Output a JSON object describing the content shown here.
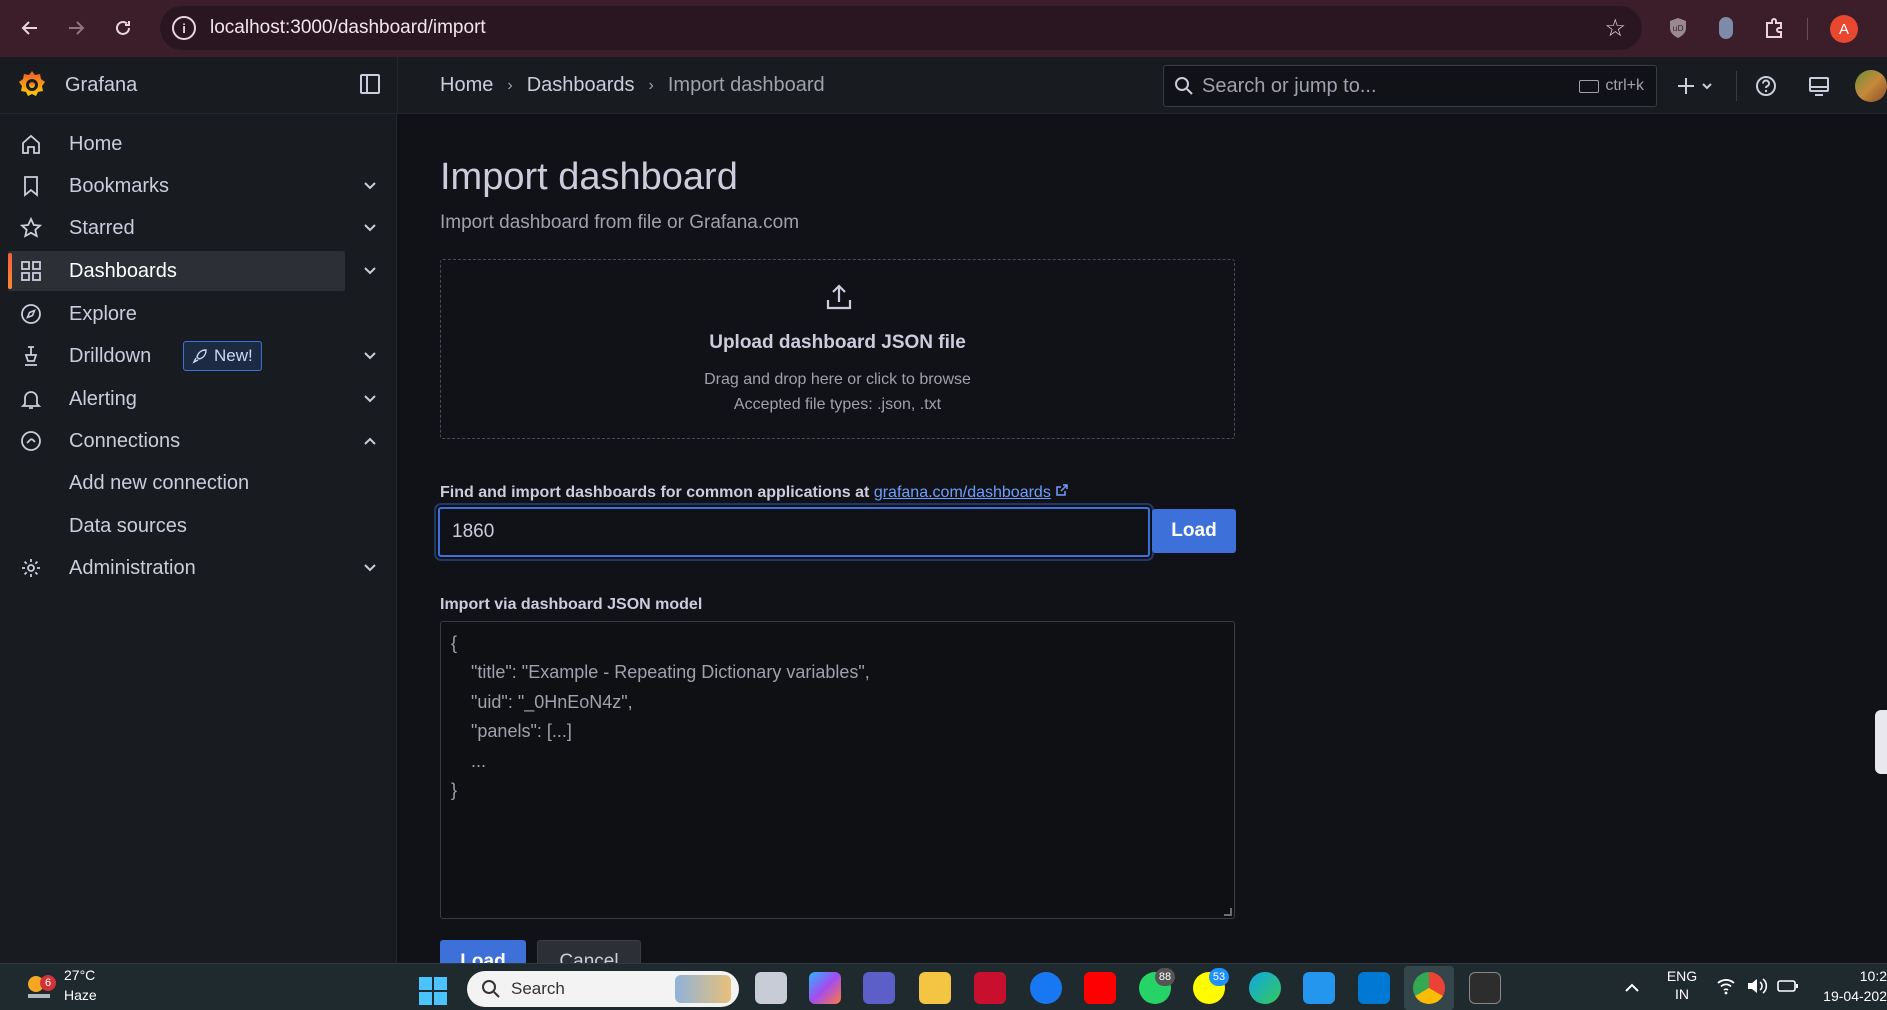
{
  "browser": {
    "url": "localhost:3000/dashboard/import",
    "profile_initial": "A"
  },
  "header": {
    "brand": "Grafana",
    "breadcrumb": [
      "Home",
      "Dashboards",
      "Import dashboard"
    ],
    "search_placeholder": "Search or jump to...",
    "search_shortcut": "ctrl+k"
  },
  "sidebar": {
    "items": [
      {
        "label": "Home",
        "icon": "home-icon"
      },
      {
        "label": "Bookmarks",
        "icon": "bookmark-icon",
        "expandable": true
      },
      {
        "label": "Starred",
        "icon": "star-icon",
        "expandable": true
      },
      {
        "label": "Dashboards",
        "icon": "apps-icon",
        "expandable": true,
        "active": true
      },
      {
        "label": "Explore",
        "icon": "compass-icon"
      },
      {
        "label": "Drilldown",
        "icon": "drilldown-icon",
        "expandable": true,
        "badge": "New!"
      },
      {
        "label": "Alerting",
        "icon": "bell-icon",
        "expandable": true
      },
      {
        "label": "Connections",
        "icon": "link-icon",
        "expanded": true
      },
      {
        "label": "Add new connection"
      },
      {
        "label": "Data sources"
      },
      {
        "label": "Administration",
        "icon": "cog-icon",
        "expandable": true
      }
    ]
  },
  "main": {
    "title": "Import dashboard",
    "subtitle": "Import dashboard from file or Grafana.com",
    "upload": {
      "title": "Upload dashboard JSON file",
      "hint": "Drag and drop here or click to browse",
      "types": "Accepted file types: .json, .txt"
    },
    "find": {
      "label": "Find and import dashboards for common applications at",
      "link": "grafana.com/dashboards",
      "value": "1860",
      "load_label": "Load"
    },
    "json": {
      "label": "Import via dashboard JSON model",
      "placeholder": "{\n    \"title\": \"Example - Repeating Dictionary variables\",\n    \"uid\": \"_0HnEoN4z\",\n    \"panels\": [...]\n    ...\n}"
    },
    "actions": {
      "load_label": "Load",
      "cancel_label": "Cancel"
    }
  },
  "taskbar": {
    "weather_temp": "27°C",
    "weather_cond": "Haze",
    "weather_badge": "6",
    "search_label": "Search",
    "whatsapp_badge": "88",
    "app_badge": "53",
    "lang_top": "ENG",
    "lang_bottom": "IN",
    "time": "10:2",
    "date": "19-04-202"
  }
}
